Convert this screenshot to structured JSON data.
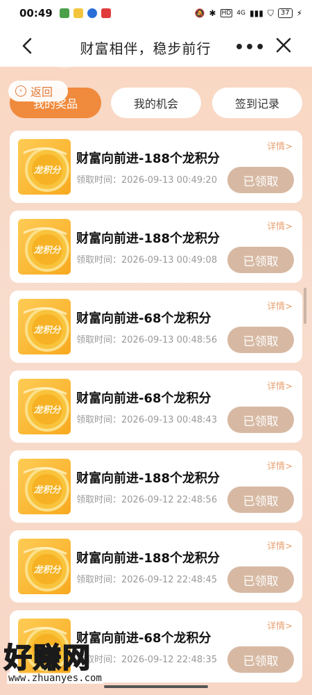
{
  "status_bar": {
    "time": "00:49",
    "network": "HD",
    "signal": "4G",
    "battery": "37"
  },
  "title_bar": {
    "title": "财富相伴，稳步前行",
    "more_label": "•••"
  },
  "back_pill": {
    "label": "返回"
  },
  "tabs": [
    {
      "label": "我的奖品",
      "active": true
    },
    {
      "label": "我的机会",
      "active": false
    },
    {
      "label": "签到记录",
      "active": false
    }
  ],
  "cards": [
    {
      "title": "财富向前进-188个龙积分",
      "time_label": "领取时间：",
      "time": "2026-09-13 00:49:20",
      "detail": "详情>",
      "status": "已领取"
    },
    {
      "title": "财富向前进-188个龙积分",
      "time_label": "领取时间：",
      "time": "2026-09-13 00:49:08",
      "detail": "详情>",
      "status": "已领取"
    },
    {
      "title": "财富向前进-68个龙积分",
      "time_label": "领取时间：",
      "time": "2026-09-13 00:48:56",
      "detail": "详情>",
      "status": "已领取"
    },
    {
      "title": "财富向前进-68个龙积分",
      "time_label": "领取时间：",
      "time": "2026-09-13 00:48:43",
      "detail": "详情>",
      "status": "已领取"
    },
    {
      "title": "财富向前进-188个龙积分",
      "time_label": "领取时间：",
      "time": "2026-09-12 22:48:56",
      "detail": "详情>",
      "status": "已领取"
    },
    {
      "title": "财富向前进-188个龙积分",
      "time_label": "领取时间：",
      "time": "2026-09-12 22:48:45",
      "detail": "详情>",
      "status": "已领取"
    },
    {
      "title": "财富向前进-68个龙积分",
      "time_label": "领取时间：",
      "time": "2026-09-12 22:48:35",
      "detail": "详情>",
      "status": "已领取"
    }
  ],
  "coin_label": "龙积分",
  "watermark": {
    "main": "好赚网",
    "sub": "www.zhuanyes.com"
  },
  "colors": {
    "accent": "#f08a3c",
    "claimed": "#d7b9a3",
    "detail": "#e8a272",
    "background": "#f7d8c6"
  }
}
